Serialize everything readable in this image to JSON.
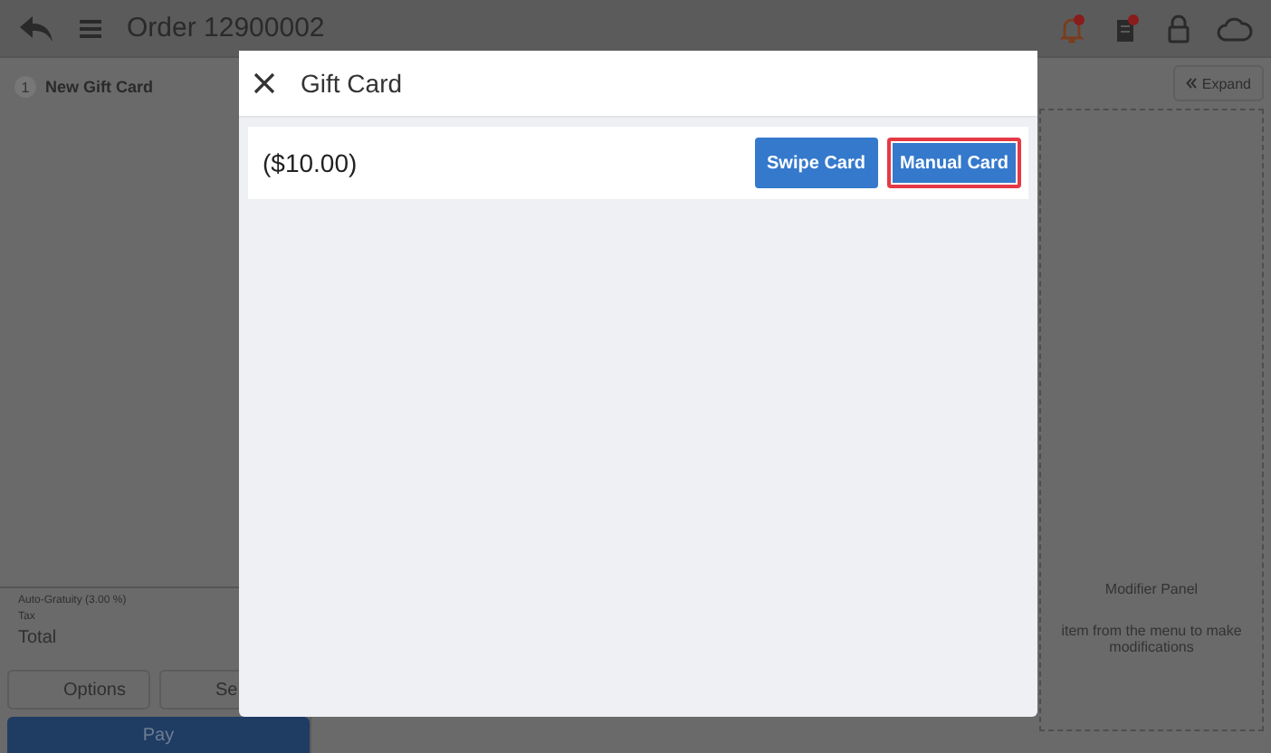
{
  "top_bar": {
    "title": "Order 12900002"
  },
  "order": {
    "items": [
      {
        "number": "1",
        "name": "New Gift Card"
      }
    ],
    "summary": [
      "Auto-Gratuity (3.00 %)",
      "Tax",
      "Total"
    ],
    "buttons": [
      "Options",
      "Se"
    ],
    "pay_button": "Pay"
  },
  "modifier_panel": {
    "expand_button": "Expand",
    "title": "Modifier Panel",
    "hint": "item from the menu to make modifications"
  },
  "dialog": {
    "title": "Gift Card",
    "amount": "($10.00)",
    "buttons": [
      {
        "label": "Swipe Card",
        "highlighted": false
      },
      {
        "label": "Manual Card",
        "highlighted": true
      }
    ]
  }
}
